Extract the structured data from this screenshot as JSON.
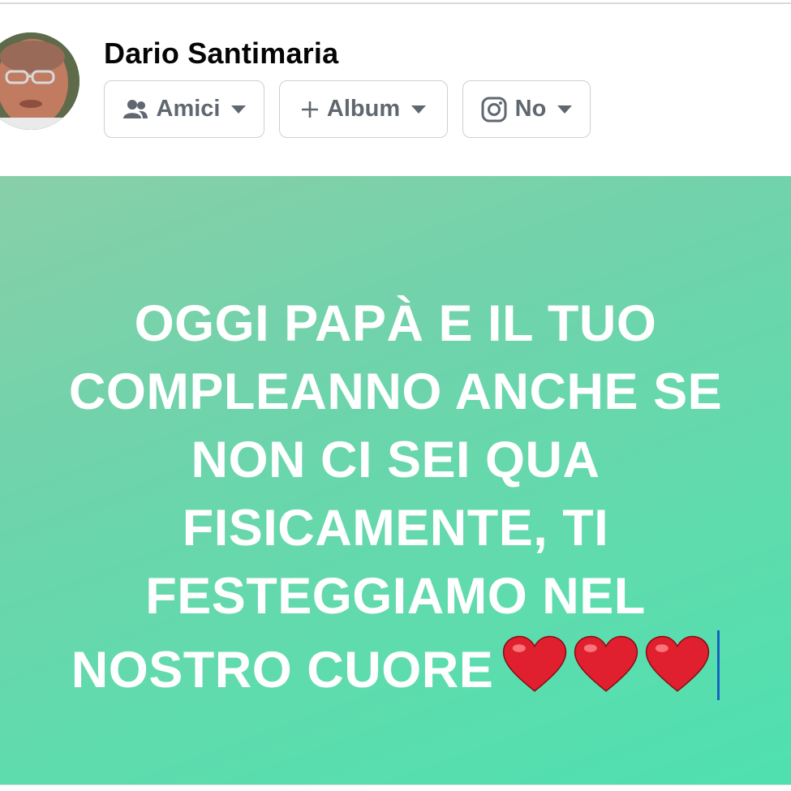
{
  "author": {
    "name": "Dario Santimaria"
  },
  "chips": {
    "privacy_label": "Amici",
    "album_label": "Album",
    "instagram_label": "No"
  },
  "icons": {
    "privacy": "friends-icon",
    "album": "plus-icon",
    "instagram": "instagram-icon",
    "caret": "caret-down-icon",
    "heart": "red-heart-emoji"
  },
  "post": {
    "lines": [
      "OGGI PAPÀ E IL TUO",
      "COMPLEANNO ANCHE SE",
      "NON CI SEI QUA",
      "FISICAMENTE, TI",
      "FESTEGGIAMO NEL",
      "NOSTRO CUORE"
    ],
    "heart_count": 3
  },
  "colors": {
    "text_dark": "#050505",
    "chip_text": "#606770",
    "bg_gradient_start": "#88cfa8",
    "bg_gradient_end": "#4fe0b0",
    "heart": "#e0202e",
    "cursor": "#1565c0"
  }
}
